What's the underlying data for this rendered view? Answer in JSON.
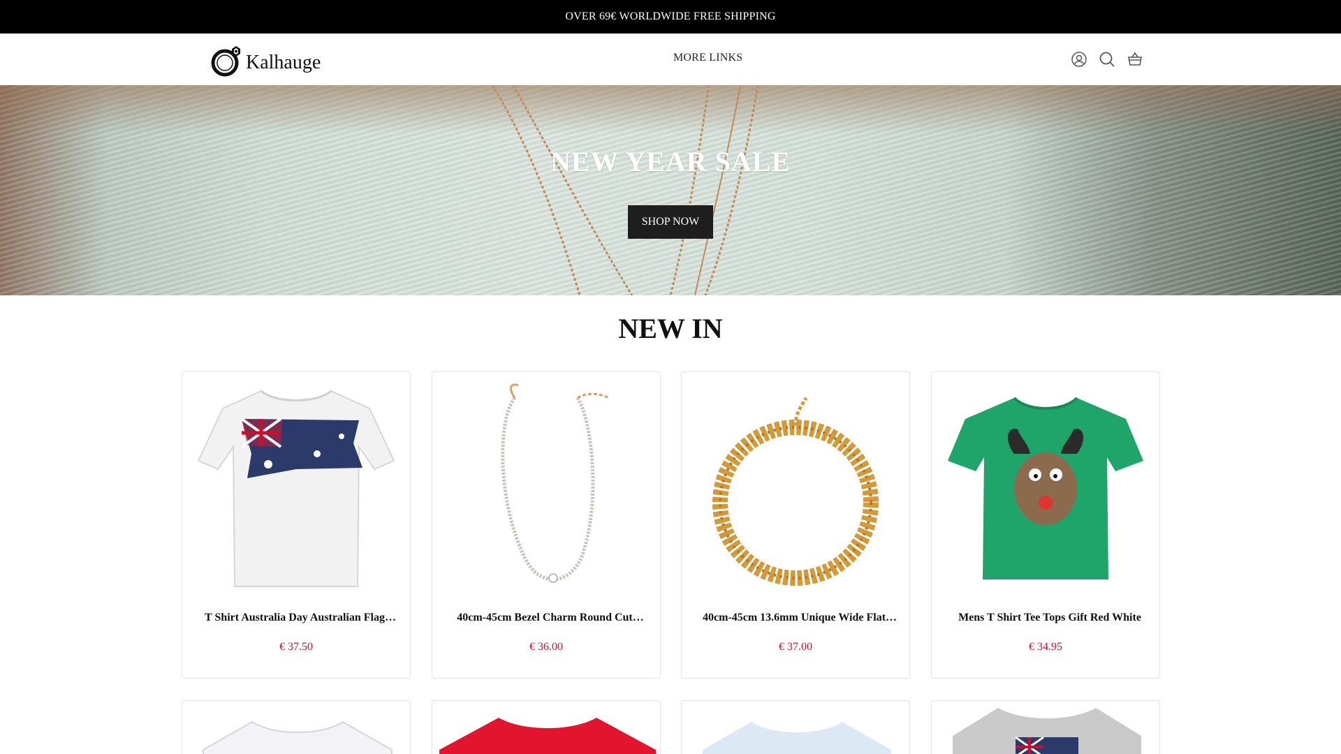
{
  "announcement": {
    "text": "OVER 69€ WORLDWIDE FREE SHIPPING"
  },
  "header": {
    "logo_text": "Kalhauge",
    "nav_links": [
      "MORE LINKS"
    ],
    "icons": [
      "account-icon",
      "search-icon",
      "cart-icon"
    ]
  },
  "hero": {
    "title": "NEW YEAR SALE",
    "button_label": "SHOP NOW"
  },
  "new_in": {
    "title": "NEW IN",
    "products": [
      {
        "title": "T Shirt Australia Day Australian Flag…",
        "price": "€ 37.50",
        "image": "white-tshirt-australia-flag"
      },
      {
        "title": "40cm-45cm Bezel Charm Round Cut…",
        "price": "€ 36.00",
        "image": "crystal-tennis-necklace"
      },
      {
        "title": "40cm-45cm 13.6mm Unique Wide Flat…",
        "price": "€ 37.00",
        "image": "gold-chain-necklace"
      },
      {
        "title": "Mens T Shirt Tee Tops Gift Red White",
        "price": "€ 34.95",
        "image": "green-reindeer-tshirt"
      }
    ],
    "second_row_images": [
      "white-tshirt",
      "red-tshirt",
      "light-blue-tshirt",
      "grey-tshirt-flag"
    ]
  },
  "colors": {
    "announcement_bg": "#000000",
    "price": "#c8102e",
    "button_bg": "#1e1e1e"
  }
}
